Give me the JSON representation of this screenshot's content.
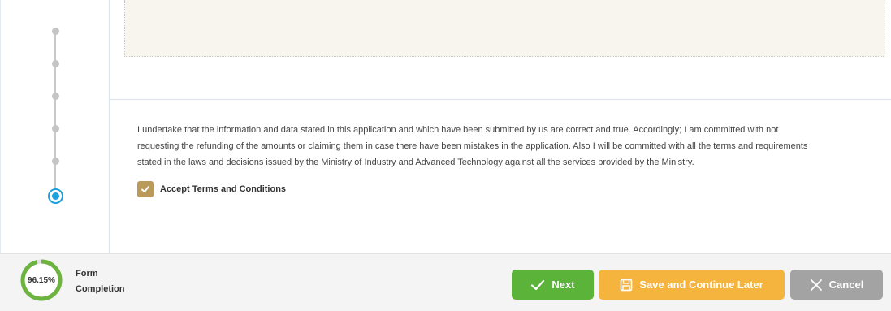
{
  "terms": {
    "line1": "I undertake that the information and data stated in this application and which have been submitted by us are correct and true. Accordingly; I am committed with not",
    "line2": "requesting the refunding of the amounts or claiming them in case there have been mistakes in the application. Also I will be committed with all the terms and requirements",
    "line3": "stated in the laws and decisions issued by the Ministry of Industry and Advanced Technology against all the services provided by the Ministry.",
    "accept_label": "Accept Terms and Conditions",
    "accepted": true
  },
  "stepper": {
    "completed_steps": 5,
    "current_step": 6
  },
  "footer": {
    "progress_text": "96.15%",
    "progress_fraction": 0.9615,
    "completion_line1": "Form",
    "completion_line2": "Completion",
    "next_label": "Next",
    "save_label": "Save and Continue Later",
    "cancel_label": "Cancel"
  },
  "colors": {
    "next": "#5bb33a",
    "save": "#f5b43e",
    "cancel": "#a3a3a3",
    "checkbox": "#b99a5b",
    "step_current": "#1ea0dc",
    "progress": "#6cb33f"
  },
  "icons": {
    "next": "check-icon",
    "save": "floppy-disk-icon",
    "cancel": "close-icon",
    "checkbox": "check-icon"
  }
}
